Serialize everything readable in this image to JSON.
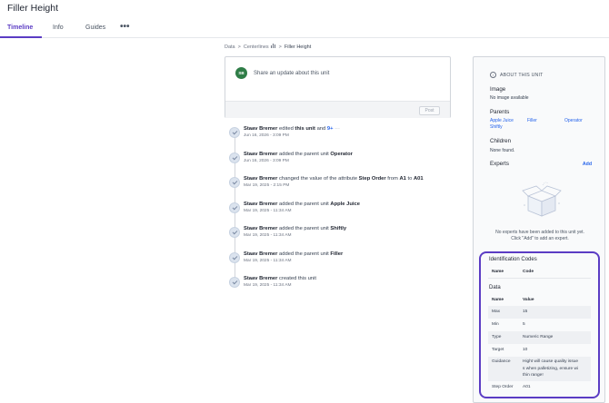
{
  "page": {
    "title": "Filler Height"
  },
  "tabs": [
    {
      "label": "Timeline",
      "active": true
    },
    {
      "label": "Info"
    },
    {
      "label": "Guides"
    }
  ],
  "more_label": "•••",
  "breadcrumb": {
    "items": [
      "Data",
      "Centerlines",
      "Filler Height"
    ],
    "centerlines_icon": "bar-chart-icon"
  },
  "post": {
    "avatar_initials": "SB",
    "placeholder": "Share an update about this unit",
    "button_label": "Post"
  },
  "timeline": [
    {
      "actor": "Staav Bremer",
      "pre": " edited ",
      "bold": "this unit",
      "mid": " and ",
      "link": "9+",
      "extra": " ···",
      "date": "Jun 16, 2026 - 3:09 PM"
    },
    {
      "actor": "Staav Bremer",
      "pre": " added the parent unit ",
      "bold": "Operator",
      "date": "Jun 16, 2026 - 3:09 PM"
    },
    {
      "actor": "Staav Bremer",
      "pre": " changed the value of the attribute ",
      "bold": "Step Order",
      "mid": " from ",
      "bold2": "A1",
      "mid2": " to ",
      "bold3": "A01",
      "date": "Mar 19, 2025 - 2:15 PM"
    },
    {
      "actor": "Staav Bremer",
      "pre": " added the parent unit ",
      "bold": "Apple Juice",
      "date": "Mar 19, 2025 - 11:34 AM"
    },
    {
      "actor": "Staav Bremer",
      "pre": " added the parent unit ",
      "bold": "Shiftly",
      "date": "Mar 19, 2025 - 11:34 AM"
    },
    {
      "actor": "Staav Bremer",
      "pre": " added the parent unit ",
      "bold": "Filler",
      "date": "Mar 19, 2025 - 11:34 AM"
    },
    {
      "actor": "Staav Bremer",
      "pre": " created this unit",
      "date": "Mar 19, 2025 - 11:34 AM"
    }
  ],
  "about": {
    "heading": "ABOUT THIS UNIT",
    "image_label": "Image",
    "image_value": "No image available",
    "parents_label": "Parents",
    "parents": [
      "Apple Juice",
      "Filler",
      "Operator",
      "Shiftly"
    ],
    "children_label": "Children",
    "children_value": "None found.",
    "experts_label": "Experts",
    "experts_add": "Add",
    "no_experts_line1": "No experts have been added to this unit yet.",
    "no_experts_line2": "Click \"Add\" to add an expert."
  },
  "identification": {
    "title": "Identification Codes",
    "headers": [
      "Name",
      "Code"
    ]
  },
  "data_table": {
    "title": "Data",
    "headers": [
      "Name",
      "Value"
    ],
    "rows": [
      {
        "name": "Max",
        "value": "15"
      },
      {
        "name": "Min",
        "value": "5"
      },
      {
        "name": "Type",
        "value": "Numeric Range"
      },
      {
        "name": "Target",
        "value": "10"
      },
      {
        "name": "Guidance",
        "value_lines": [
          "Hight will cause quality issue",
          "s when palletizing, ensure wi",
          "thin range!"
        ]
      },
      {
        "name": "Step Order",
        "value": "A01"
      }
    ]
  },
  "colors": {
    "accent": "#5b3cc4",
    "link": "#2563eb",
    "avatar": "#2f7d47"
  }
}
